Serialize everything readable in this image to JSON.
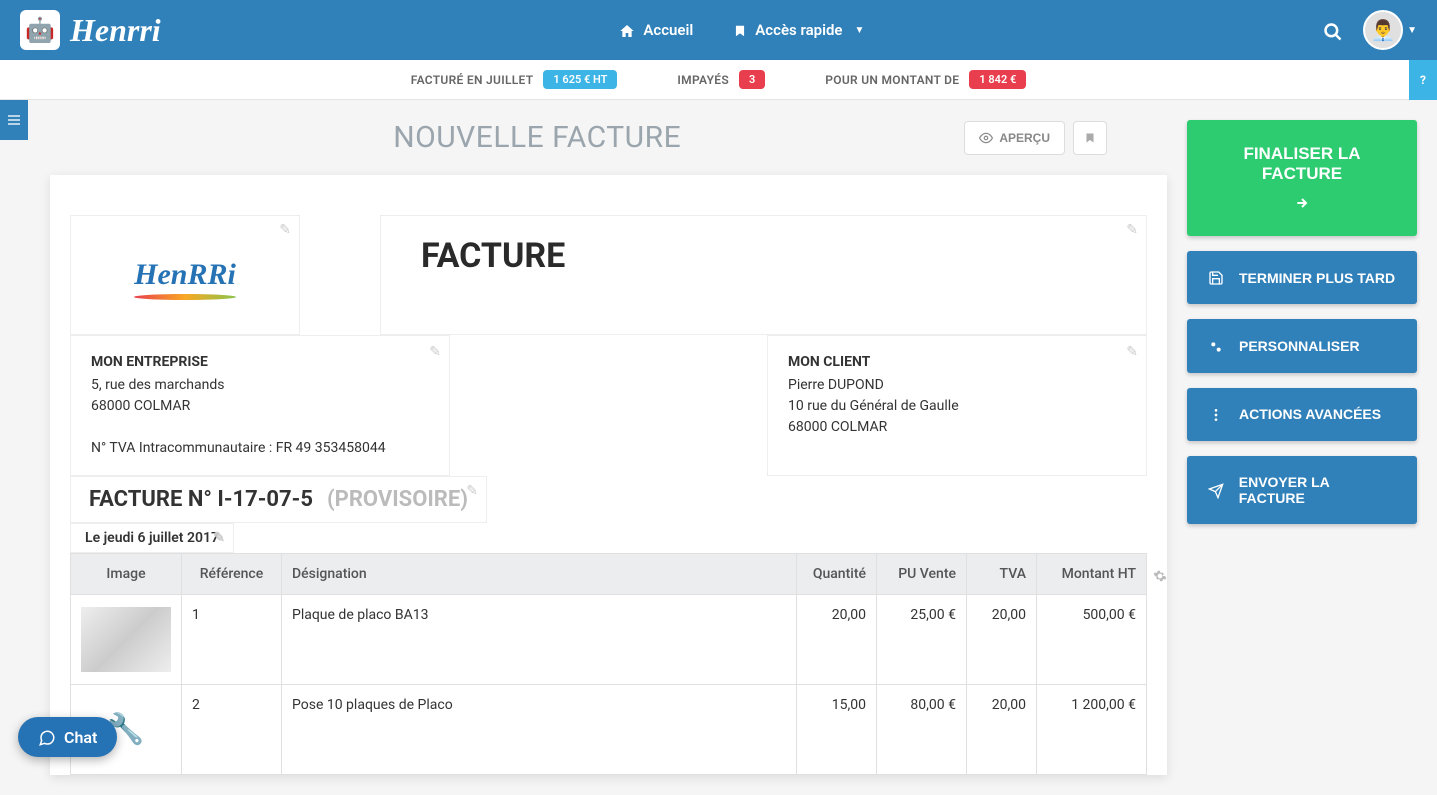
{
  "brand": "Henrri",
  "nav": {
    "home": "Accueil",
    "quick": "Accès rapide"
  },
  "stats": {
    "billed_label": "FACTURÉ EN JUILLET",
    "billed_value": "1 625 € HT",
    "unpaid_label": "IMPAYÉS",
    "unpaid_count": "3",
    "amount_label": "POUR UN MONTANT DE",
    "amount_value": "1 842 €"
  },
  "page": {
    "title": "NOUVELLE FACTURE",
    "preview": "APERÇU"
  },
  "invoice": {
    "logo_text": "HenRRi",
    "doc_type": "FACTURE",
    "company": {
      "title": "MON ENTREPRISE",
      "street": "5, rue des marchands",
      "city": "68000 COLMAR",
      "vat": "N° TVA Intracommunautaire : FR 49 353458044"
    },
    "client": {
      "title": "MON CLIENT",
      "name": "Pierre DUPOND",
      "street": "10 rue du Général de Gaulle",
      "city": "68000 COLMAR"
    },
    "number_label": "FACTURE N° I-17-07-5",
    "status": "(PROVISOIRE)",
    "date": "Le jeudi 6 juillet 2017",
    "columns": {
      "image": "Image",
      "ref": "Référence",
      "designation": "Désignation",
      "qty": "Quantité",
      "pu": "PU Vente",
      "tva": "TVA",
      "total": "Montant HT"
    },
    "items": [
      {
        "ref": "1",
        "designation": "Plaque de placo BA13",
        "qty": "20,00",
        "pu": "25,00 €",
        "tva": "20,00",
        "total": "500,00 €"
      },
      {
        "ref": "2",
        "designation": "Pose 10 plaques de Placo",
        "qty": "15,00",
        "pu": "80,00 €",
        "tva": "20,00",
        "total": "1 200,00 €"
      }
    ]
  },
  "actions": {
    "finalize": "FINALISER LA FACTURE",
    "save_later": "TERMINER PLUS TARD",
    "customize": "PERSONNALISER",
    "advanced": "ACTIONS AVANCÉES",
    "send": "ENVOYER LA FACTURE"
  },
  "chat": "Chat"
}
